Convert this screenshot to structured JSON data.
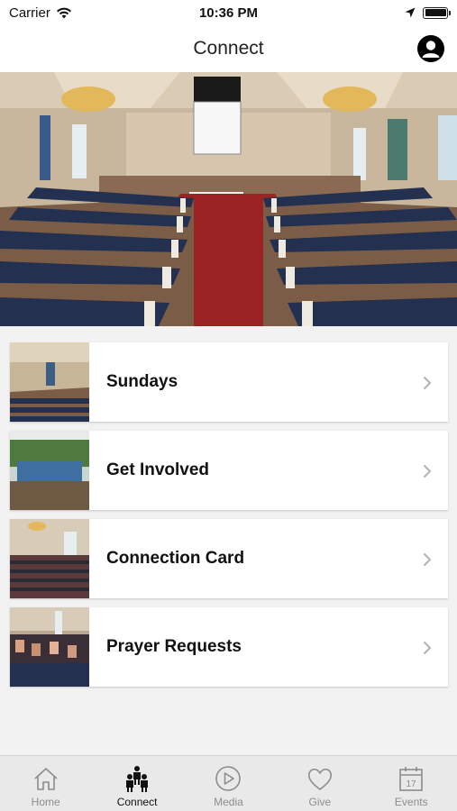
{
  "status_bar": {
    "carrier": "Carrier",
    "time": "10:36 PM"
  },
  "nav": {
    "title": "Connect"
  },
  "list": [
    {
      "label": "Sundays"
    },
    {
      "label": "Get Involved"
    },
    {
      "label": "Connection Card"
    },
    {
      "label": "Prayer Requests"
    }
  ],
  "tabs": [
    {
      "label": "Home",
      "icon": "home-icon"
    },
    {
      "label": "Connect",
      "icon": "people-icon",
      "active": true
    },
    {
      "label": "Media",
      "icon": "play-icon"
    },
    {
      "label": "Give",
      "icon": "heart-icon"
    },
    {
      "label": "Events",
      "icon": "calendar-icon"
    }
  ],
  "colors": {
    "background": "#f2f2f2",
    "tab_bar": "#e9e9e9",
    "active_tab": "#111111",
    "inactive_tab": "#8c8c8c"
  }
}
